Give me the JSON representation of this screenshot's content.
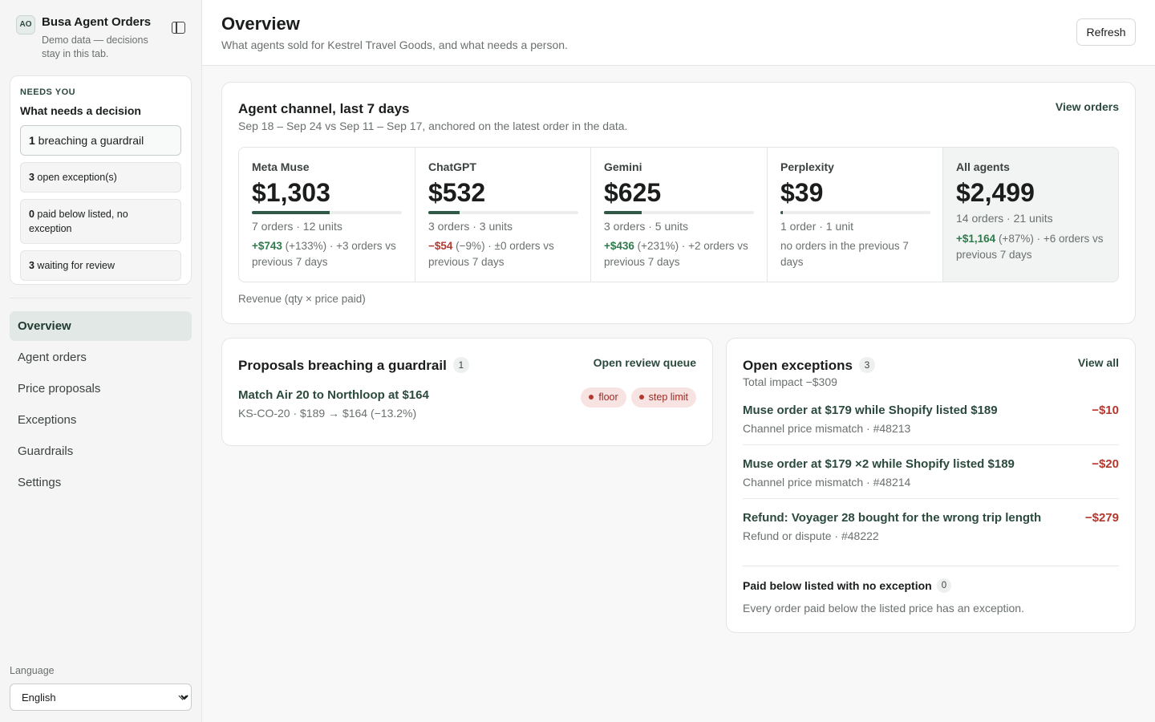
{
  "brand": {
    "initials": "AO",
    "title": "Busa Agent Orders",
    "subtitle": "Demo data — decisions stay in this tab."
  },
  "needs": {
    "kicker": "NEEDS YOU",
    "title": "What needs a decision",
    "items": [
      {
        "count": "1",
        "label": " breaching a guardrail"
      },
      {
        "count": "3",
        "label": " open exception(s)"
      },
      {
        "count": "0",
        "label": " paid below listed, no exception"
      },
      {
        "count": "3",
        "label": " waiting for review"
      }
    ]
  },
  "nav": {
    "items": [
      {
        "label": "Overview",
        "active": true
      },
      {
        "label": "Agent orders"
      },
      {
        "label": "Price proposals"
      },
      {
        "label": "Exceptions"
      },
      {
        "label": "Guardrails"
      },
      {
        "label": "Settings"
      }
    ]
  },
  "language": {
    "label": "Language",
    "selected": "English"
  },
  "header": {
    "title": "Overview",
    "subtitle": "What agents sold for Kestrel Travel Goods, and what needs a person.",
    "refresh_label": "Refresh"
  },
  "agent_channel": {
    "title": "Agent channel, last 7 days",
    "subtitle": "Sep 18 – Sep 24 vs Sep 11 – Sep 17, anchored on the latest order in the data.",
    "link": "View orders",
    "agents": [
      {
        "name": "Meta Muse",
        "amount": "$1,303",
        "share": 0.52,
        "meta": "7 orders · 12 units",
        "delta": "+$743",
        "delta_rest": " (+133%) · +3 orders vs previous 7 days",
        "delta_sign": "pos"
      },
      {
        "name": "ChatGPT",
        "amount": "$532",
        "share": 0.21,
        "meta": "3 orders · 3 units",
        "delta": "−$54",
        "delta_rest": " (−9%) · ±0 orders vs previous 7 days",
        "delta_sign": "neg"
      },
      {
        "name": "Gemini",
        "amount": "$625",
        "share": 0.25,
        "meta": "3 orders · 5 units",
        "delta": "+$436",
        "delta_rest": " (+231%) · +2 orders vs previous 7 days",
        "delta_sign": "pos"
      },
      {
        "name": "Perplexity",
        "amount": "$39",
        "share": 0.016,
        "meta": "1 order · 1 unit",
        "delta": "",
        "delta_rest": "no orders in the previous 7 days",
        "delta_sign": "none"
      }
    ],
    "total": {
      "name": "All agents",
      "amount": "$2,499",
      "meta": "14 orders · 21 units",
      "delta": "+$1,164",
      "delta_rest": " (+87%) · +6 orders vs previous 7 days"
    },
    "note": "Revenue (qty × price paid)"
  },
  "proposals": {
    "title": "Proposals breaching a guardrail",
    "count": "1",
    "link": "Open review queue",
    "item": {
      "title": "Match Air 20 to Northloop at $164",
      "meta": "KS-CO-20 · $189 → $164 (−13.2%)",
      "tags": [
        "floor",
        "step limit"
      ]
    }
  },
  "exceptions": {
    "title": "Open exceptions",
    "count": "3",
    "link": "View all",
    "total": "Total impact −$309",
    "items": [
      {
        "title": "Muse order at $179 while Shopify listed $189",
        "meta": "Channel price mismatch · #48213",
        "amount": "−$10"
      },
      {
        "title": "Muse order at $179 ×2 while Shopify listed $189",
        "meta": "Channel price mismatch · #48214",
        "amount": "−$20"
      },
      {
        "title": "Refund: Voyager 28 bought for the wrong trip length",
        "meta": "Refund or dispute · #48222",
        "amount": "−$279"
      }
    ],
    "paid_below": {
      "title": "Paid below listed with no exception",
      "count": "0",
      "note": "Every order paid below the listed price has an exception."
    }
  }
}
